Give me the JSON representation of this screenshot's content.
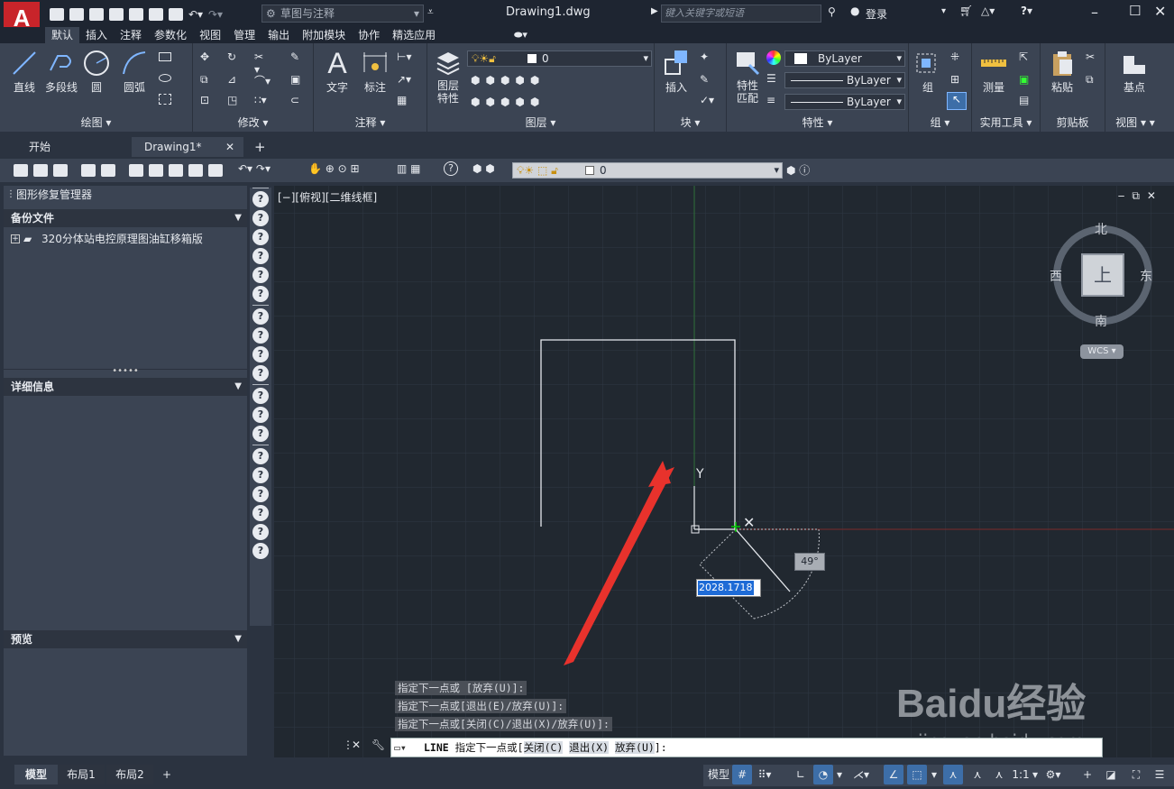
{
  "app": {
    "logo": "A",
    "workspace": "草图与注释",
    "doc_title": "Drawing1.dwg",
    "search_placeholder": "键入关键字或短语",
    "login": "登录"
  },
  "ribbon_tabs": [
    "默认",
    "插入",
    "注释",
    "参数化",
    "视图",
    "管理",
    "输出",
    "附加模块",
    "协作",
    "精选应用"
  ],
  "ribbon": {
    "draw": {
      "line": "直线",
      "polyline": "多段线",
      "circle": "圆",
      "arc": "圆弧",
      "label": "绘图"
    },
    "modify": {
      "label": "修改"
    },
    "annotation": {
      "text": "文字",
      "dimension": "标注",
      "label": "注释"
    },
    "layers": {
      "layer_props": "图层",
      "layer_props2": "特性",
      "current_layer": "0",
      "label": "图层"
    },
    "block": {
      "insert": "插入",
      "label": "块"
    },
    "properties": {
      "match": "特性",
      "match2": "匹配",
      "color": "ByLayer",
      "linetype": "ByLayer",
      "lineweight": "ByLayer",
      "label": "特性"
    },
    "groups": {
      "group": "组",
      "label": "组"
    },
    "utilities": {
      "measure": "测量",
      "label": "实用工具"
    },
    "clipboard": {
      "paste": "粘贴",
      "label": "剪贴板"
    },
    "view": {
      "base": "基点",
      "label": "视图"
    }
  },
  "doc_tabs": [
    {
      "label": "开始"
    },
    {
      "label": "Drawing1*"
    }
  ],
  "toolbar2": {
    "layer_value": "0"
  },
  "left_panel": {
    "title": "图形修复管理器",
    "backup_header": "备份文件",
    "backup_item": "320分体站电控原理图油缸移箱版",
    "details_header": "详细信息",
    "preview_header": "预览"
  },
  "viewport": {
    "label": "[−][俯视][二维线框]",
    "viewcube": {
      "north": "北",
      "south": "南",
      "west": "西",
      "east": "东",
      "top": "上",
      "wcs": "WCS"
    },
    "length_input": "2028.1718",
    "angle_tooltip": "49°",
    "y_axis": "Y"
  },
  "command": {
    "history": [
      "指定下一点或 [放弃(U)]:",
      "指定下一点或[退出(E)/放弃(U)]:",
      "指定下一点或[关闭(C)/退出(X)/放弃(U)]:"
    ],
    "current_cmd": "LINE",
    "prompt": "指定下一点或[",
    "opt_close": "关闭(C)",
    "opt_exit": "退出(X)",
    "opt_undo": "放弃(U)",
    "prompt_end": "]:"
  },
  "layout_tabs": [
    "模型",
    "布局1",
    "布局2"
  ],
  "status": {
    "model": "模型",
    "scale": "1:1"
  },
  "watermark": {
    "brand": "Baidu经验",
    "url": "jingyan.baidu.com"
  },
  "colors": {
    "arrow": "#e8322c",
    "accent": "#3d6ea8",
    "cursor_green": "#00c800"
  }
}
